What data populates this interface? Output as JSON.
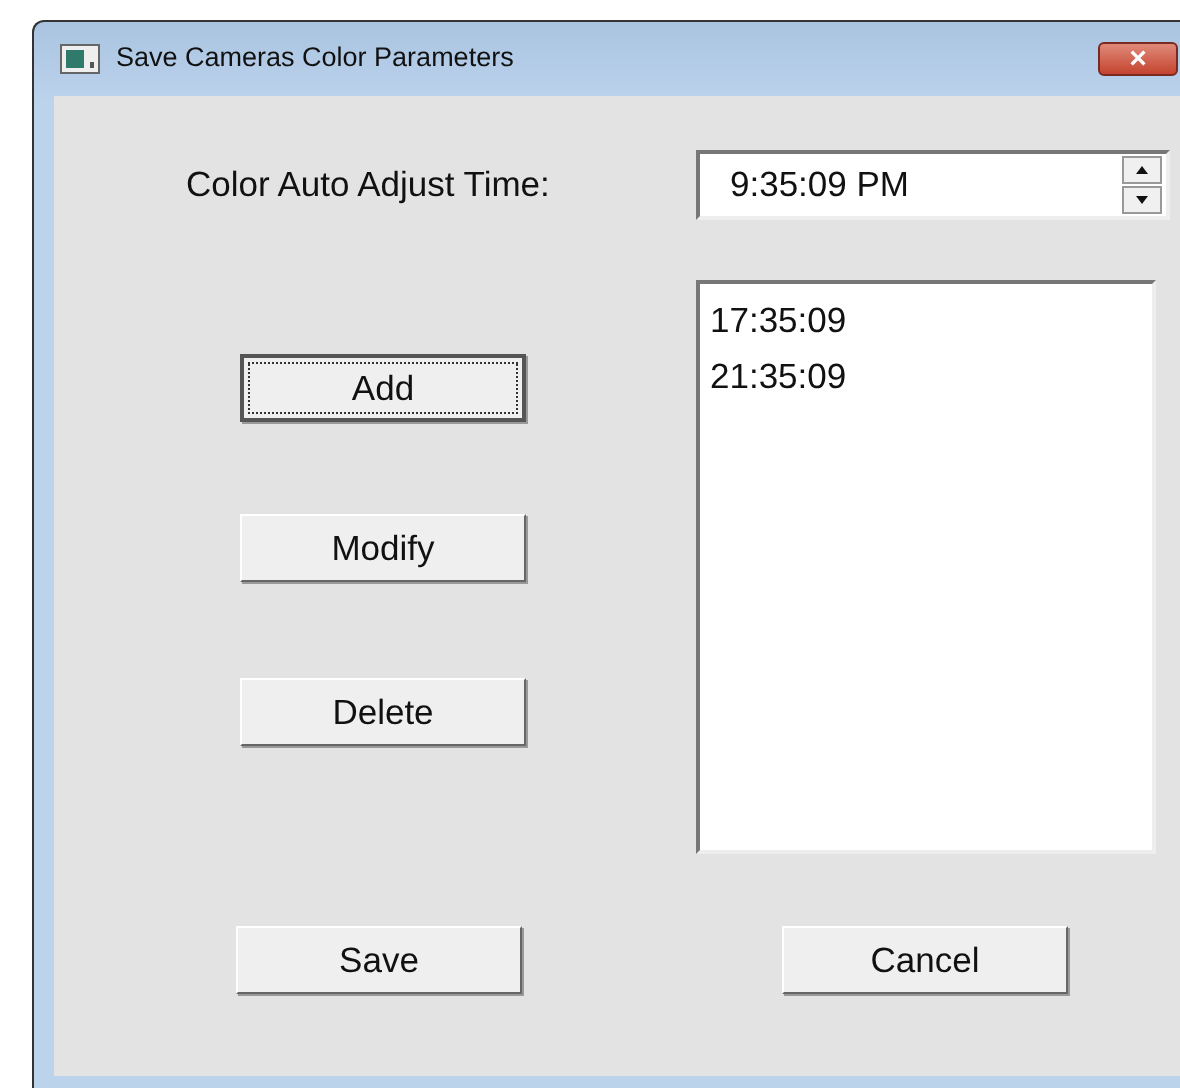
{
  "window": {
    "title": "Save Cameras Color Parameters",
    "close": "×"
  },
  "time_field": {
    "label": "Color Auto Adjust Time:",
    "value": "9:35:09 PM"
  },
  "list": {
    "items": [
      {
        "text": "17:35:09"
      },
      {
        "text": "21:35:09"
      }
    ]
  },
  "side_buttons": [
    {
      "label": "Add",
      "focused": true
    },
    {
      "label": "Modify",
      "focused": false
    },
    {
      "label": "Delete",
      "focused": false
    }
  ],
  "bottom_buttons": [
    {
      "label": "Save",
      "focused": false
    },
    {
      "label": "Cancel",
      "focused": false
    }
  ]
}
